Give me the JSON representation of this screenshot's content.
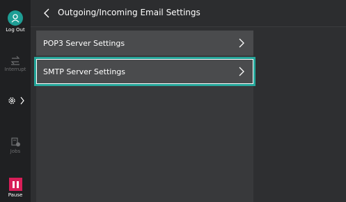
{
  "rail": {
    "logout_label": "Log Out",
    "interrupt_label": "Interrupt",
    "jobs_label": "Jobs",
    "pause_label": "Pause",
    "accent": "#1e9e95",
    "pause_color": "#d81e58"
  },
  "header": {
    "title": "Outgoing/Incoming Email Settings"
  },
  "list": {
    "items": [
      {
        "label": "POP3 Server Settings"
      },
      {
        "label": "SMTP Server Settings",
        "selected": true
      }
    ]
  },
  "icons": {
    "logout": "user-icon",
    "interrupt": "interrupt-icon",
    "settings": "gear-icon",
    "jobs": "jobs-icon",
    "pause": "pause-icon",
    "back": "chevron-left-icon",
    "row_arrow": "chevron-right-icon"
  },
  "selection_color": "#25a69a"
}
